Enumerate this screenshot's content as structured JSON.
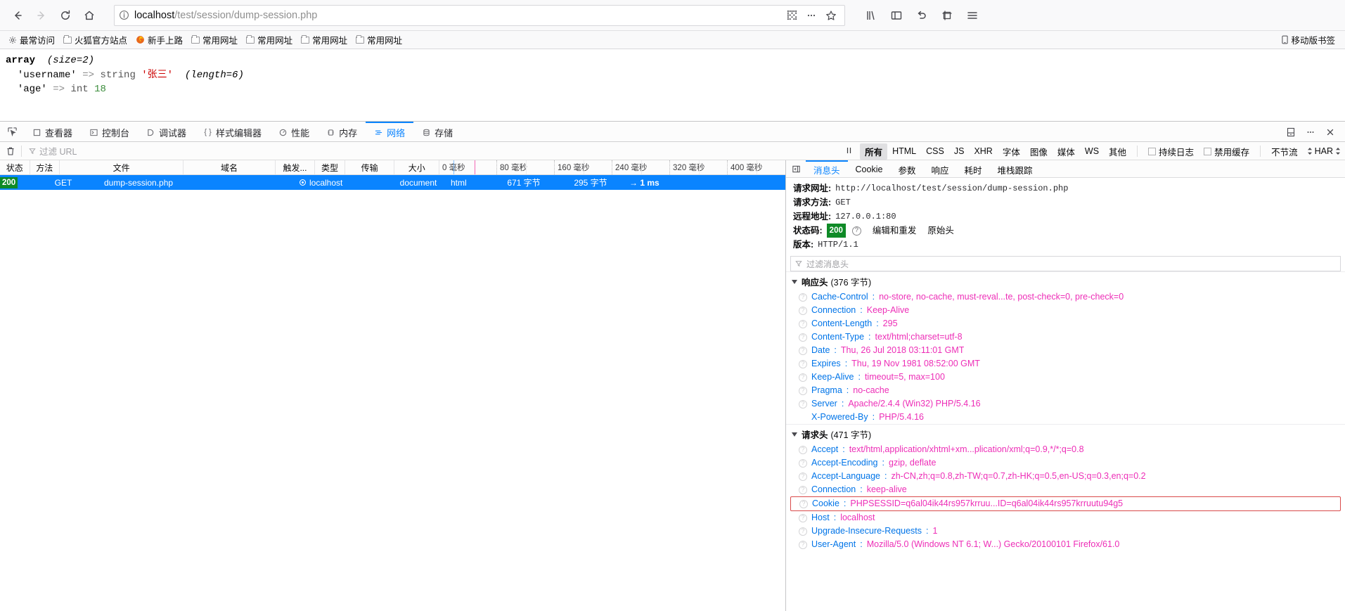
{
  "browser": {
    "url_host": "localhost",
    "url_path": "/test/session/dump-session.php",
    "back_icon": "back-arrow-icon",
    "forward_icon": "forward-arrow-icon",
    "reload_icon": "reload-icon",
    "home_icon": "home-icon",
    "identity_icon": "info-icon",
    "qr_icon": "qr-code-icon",
    "more_icon": "ellipsis-icon",
    "bookmark_star_icon": "star-icon",
    "library_icon": "library-icon",
    "sidebar_icon": "sidebar-icon",
    "sync_icon": "sync-arrow-icon",
    "screenshot_icon": "screenshot-icon",
    "menu_icon": "hamburger-menu-icon"
  },
  "bookmarks": {
    "items": [
      {
        "label": "最常访问",
        "icon": "gear-icon"
      },
      {
        "label": "火狐官方站点",
        "icon": "folder-icon"
      },
      {
        "label": "新手上路",
        "icon": "firefox-icon"
      },
      {
        "label": "常用网址",
        "icon": "folder-icon"
      },
      {
        "label": "常用网址",
        "icon": "folder-icon"
      },
      {
        "label": "常用网址",
        "icon": "folder-icon"
      },
      {
        "label": "常用网址",
        "icon": "folder-icon"
      }
    ],
    "mobile": {
      "label": "移动版书签",
      "icon": "mobile-icon"
    }
  },
  "page": {
    "dump": {
      "line1_kw": "array",
      "line1_size": "(size=2)",
      "row1": {
        "key": "'username'",
        "arrow": "=>",
        "type": "string",
        "value": "'张三'",
        "length": "(length=6)"
      },
      "row2": {
        "key": "'age'",
        "arrow": "=>",
        "type": "int",
        "value": "18"
      }
    }
  },
  "devtools": {
    "picker_icon": "element-picker-icon",
    "tabs": [
      {
        "label": "查看器",
        "icon": "inspector-icon",
        "active": false
      },
      {
        "label": "控制台",
        "icon": "console-icon",
        "active": false
      },
      {
        "label": "调试器",
        "icon": "debugger-icon",
        "active": false
      },
      {
        "label": "样式编辑器",
        "icon": "style-editor-icon",
        "active": false
      },
      {
        "label": "性能",
        "icon": "performance-icon",
        "active": false
      },
      {
        "label": "内存",
        "icon": "memory-icon",
        "active": false
      },
      {
        "label": "网络",
        "icon": "network-icon",
        "active": true
      },
      {
        "label": "存储",
        "icon": "storage-icon",
        "active": false
      }
    ],
    "right_icons": [
      {
        "name": "dock-layout-icon"
      },
      {
        "name": "ellipsis-icon"
      },
      {
        "name": "close-icon"
      }
    ]
  },
  "network_toolbar": {
    "clear_icon": "trash-icon",
    "filter_icon": "funnel-icon",
    "filter_placeholder": "过滤 URL",
    "pause_icon": "pause-icon",
    "type_filters": [
      {
        "label": "所有",
        "active": true
      },
      {
        "label": "HTML",
        "active": false
      },
      {
        "label": "CSS",
        "active": false
      },
      {
        "label": "JS",
        "active": false
      },
      {
        "label": "XHR",
        "active": false
      },
      {
        "label": "字体",
        "active": false
      },
      {
        "label": "图像",
        "active": false
      },
      {
        "label": "媒体",
        "active": false
      },
      {
        "label": "WS",
        "active": false
      },
      {
        "label": "其他",
        "active": false
      }
    ],
    "checkboxes": [
      {
        "label": "持续日志",
        "checked": false
      },
      {
        "label": "禁用缓存",
        "checked": false
      }
    ],
    "throttle_label": "不节流",
    "har_label": "HAR"
  },
  "request_table": {
    "columns": [
      "状态",
      "方法",
      "文件",
      "域名",
      "触发...",
      "类型",
      "传输",
      "大小"
    ],
    "timeline_ticks": [
      "0 毫秒",
      "80 毫秒",
      "160 毫秒",
      "240 毫秒",
      "320 毫秒",
      "400 毫秒"
    ],
    "rows": [
      {
        "status": "200",
        "method": "GET",
        "file": "dump-session.php",
        "domain": "localhost",
        "domain_icon": "globe-icon",
        "cause": "document",
        "type": "html",
        "transferred": "671 字节",
        "size": "295 字节",
        "time": "→ 1 ms"
      }
    ]
  },
  "detail_panel": {
    "back_icon": "panel-collapse-icon",
    "tabs": [
      {
        "label": "消息头",
        "active": true
      },
      {
        "label": "Cookie",
        "active": false
      },
      {
        "label": "参数",
        "active": false
      },
      {
        "label": "响应",
        "active": false
      },
      {
        "label": "耗时",
        "active": false
      },
      {
        "label": "堆栈跟踪",
        "active": false
      }
    ],
    "summary": {
      "url_label": "请求网址:",
      "url_value": "http://localhost/test/session/dump-session.php",
      "method_label": "请求方法:",
      "method_value": "GET",
      "remote_label": "远程地址:",
      "remote_value": "127.0.0.1:80",
      "status_label": "状态码:",
      "status_value": "200",
      "status_help_icon": "question-mark-icon",
      "edit_resend_label": "编辑和重发",
      "raw_headers_label": "原始头",
      "version_label": "版本:",
      "version_value": "HTTP/1.1"
    },
    "header_filter_placeholder": "过滤消息头",
    "response_headers": {
      "title": "响应头",
      "size": "(376 字节)",
      "items": [
        {
          "name": "Cache-Control",
          "value": "no-store, no-cache, must-reval...te, post-check=0, pre-check=0"
        },
        {
          "name": "Connection",
          "value": "Keep-Alive"
        },
        {
          "name": "Content-Length",
          "value": "295"
        },
        {
          "name": "Content-Type",
          "value": "text/html;charset=utf-8"
        },
        {
          "name": "Date",
          "value": "Thu, 26 Jul 2018 03:11:01 GMT"
        },
        {
          "name": "Expires",
          "value": "Thu, 19 Nov 1981 08:52:00 GMT"
        },
        {
          "name": "Keep-Alive",
          "value": "timeout=5, max=100"
        },
        {
          "name": "Pragma",
          "value": "no-cache"
        },
        {
          "name": "Server",
          "value": "Apache/2.4.4 (Win32) PHP/5.4.16"
        },
        {
          "name": "X-Powered-By",
          "value": "PHP/5.4.16",
          "no_icon": true
        }
      ]
    },
    "request_headers": {
      "title": "请求头",
      "size": "(471 字节)",
      "items": [
        {
          "name": "Accept",
          "value": "text/html,application/xhtml+xm...plication/xml;q=0.9,*/*;q=0.8"
        },
        {
          "name": "Accept-Encoding",
          "value": "gzip, deflate"
        },
        {
          "name": "Accept-Language",
          "value": "zh-CN,zh;q=0.8,zh-TW;q=0.7,zh-HK;q=0.5,en-US;q=0.3,en;q=0.2"
        },
        {
          "name": "Connection",
          "value": "keep-alive"
        },
        {
          "name": "Cookie",
          "value": "PHPSESSID=q6al04ik44rs957krruu...ID=q6al04ik44rs957krruutu94g5",
          "highlight": true
        },
        {
          "name": "Host",
          "value": "localhost"
        },
        {
          "name": "Upgrade-Insecure-Requests",
          "value": "1"
        },
        {
          "name": "User-Agent",
          "value": "Mozilla/5.0 (Windows NT 6.1; W...) Gecko/20100101 Firefox/61.0"
        }
      ]
    }
  },
  "colors": {
    "accent": "#0a84ff",
    "status_ok": "#0f8a27",
    "header_name": "#0074e8",
    "header_value": "#ed2eb7",
    "highlight_border": "#d94a4a"
  }
}
